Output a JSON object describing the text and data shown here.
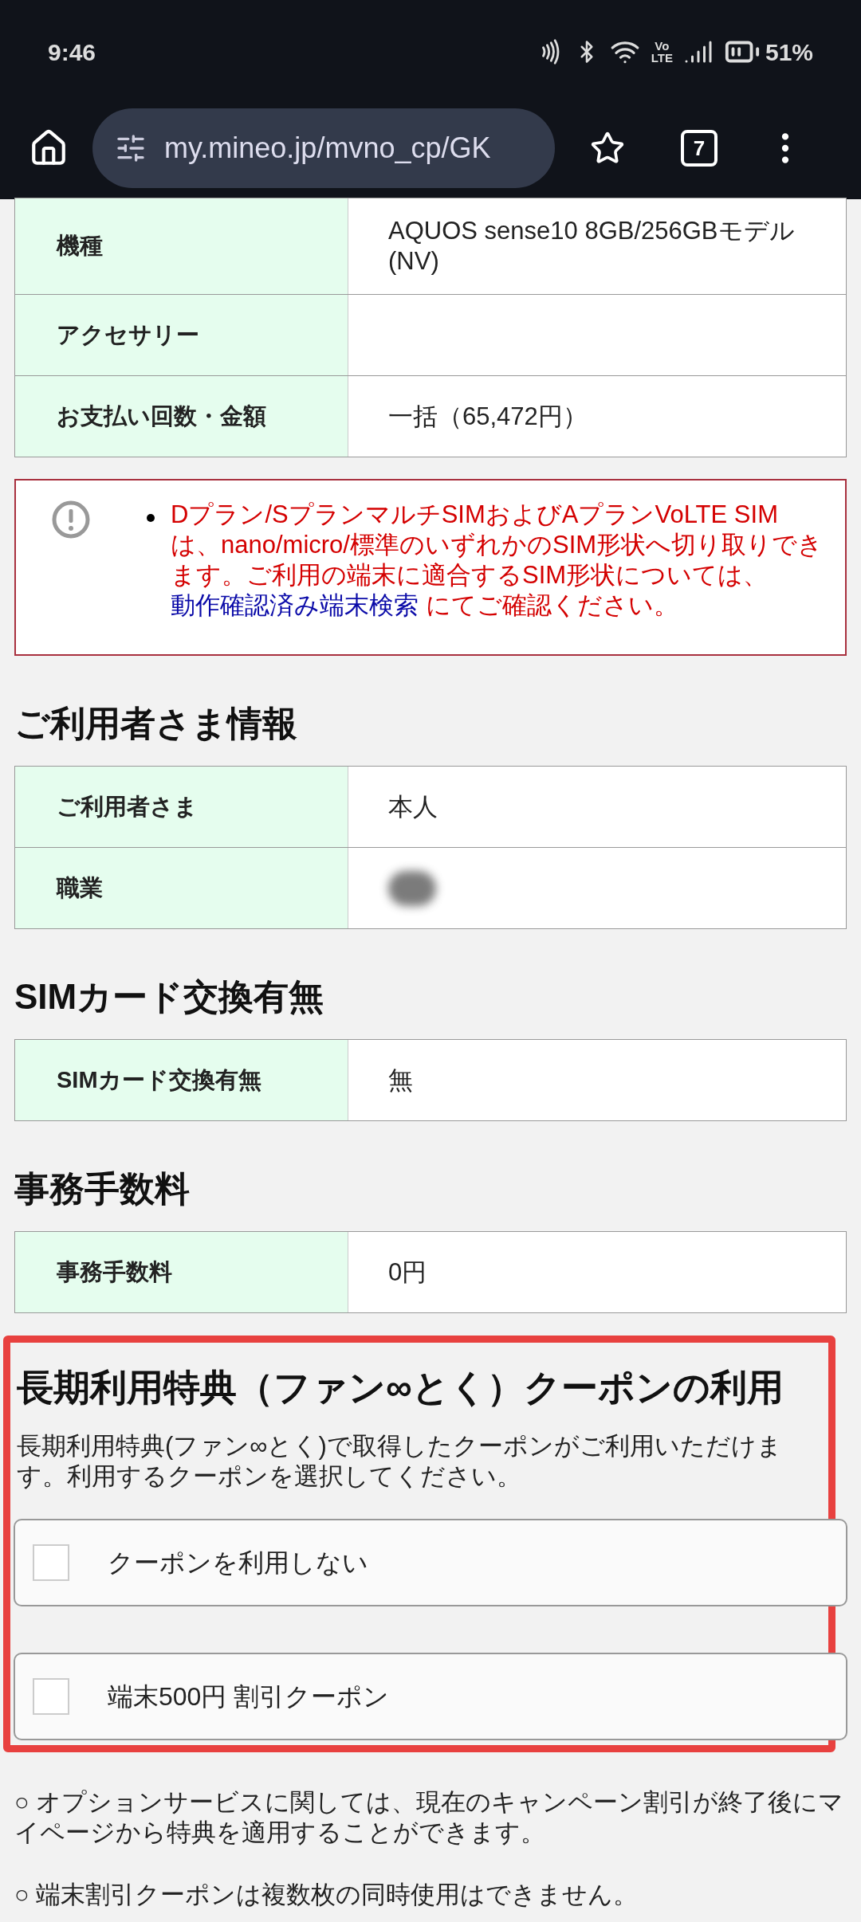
{
  "status_bar": {
    "time": "9:46",
    "network_badge": [
      "Vo",
      "LTE"
    ],
    "battery": "51%"
  },
  "browser": {
    "url": "my.mineo.jp/mvno_cp/GK",
    "tab_count": "7"
  },
  "device_table": [
    {
      "label": "機種",
      "value": "AQUOS sense10 8GB/256GBモデル(NV)"
    },
    {
      "label": "アクセサリー"
    },
    {
      "label": "お支払い回数・金額",
      "value": "一括（65,472円）"
    }
  ],
  "notice": {
    "text": "Dプラン/SプランマルチSIMおよびAプランVoLTE SIMは、nano/micro/標準のいずれかのSIM形状へ切り取りできます。ご利用の端末に適合するSIM形状については、",
    "link": "動作確認済み端末検索",
    "text_after": " にてご確認ください。"
  },
  "sections": [
    {
      "title": "ご利用者さま情報",
      "rows": [
        {
          "label": "ご利用者さま",
          "value": "本人",
          "kind": "text"
        },
        {
          "label": "職業",
          "kind": "redacted"
        }
      ]
    },
    {
      "title": "SIMカード交換有無",
      "rows": [
        {
          "label": "SIMカード交換有無",
          "value": "無",
          "kind": "text"
        }
      ]
    },
    {
      "title": "事務手数料",
      "rows": [
        {
          "label": "事務手数料",
          "value": "0円",
          "kind": "text"
        }
      ]
    }
  ],
  "coupon": {
    "title": "長期利用特典（ファン∞とく）クーポンの利用",
    "description": "長期利用特典(ファン∞とく)で取得したクーポンがご利用いただけます。利用するクーポンを選択してください。",
    "options": [
      {
        "label": "クーポンを利用しない",
        "checked": false
      },
      {
        "label": "端末500円 割引クーポン",
        "checked": false
      }
    ]
  },
  "notes": [
    "○ オプションサービスに関しては、現在のキャンペーン割引が終了後にマイページから特典を適用することができます。",
    "○ 端末割引クーポンは複数枚の同時使用はできません。"
  ]
}
